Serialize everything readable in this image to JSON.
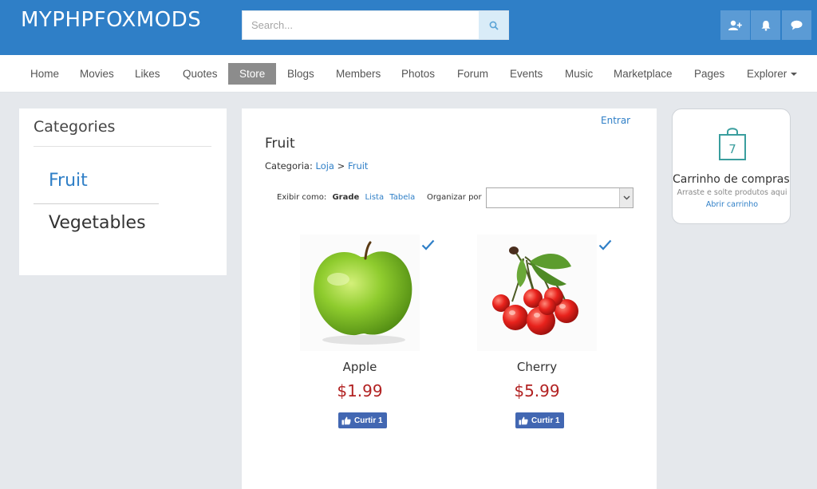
{
  "header": {
    "brand": "MYPHPFOXMODS",
    "search_placeholder": "Search...",
    "icons": [
      "search-icon",
      "add-friend-icon",
      "bell-icon",
      "chat-icon"
    ],
    "brand_color": "#2f7fc7"
  },
  "nav": {
    "items": [
      {
        "label": "Home"
      },
      {
        "label": "Movies"
      },
      {
        "label": "Likes"
      },
      {
        "label": "Quotes"
      },
      {
        "label": "Store"
      },
      {
        "label": "Blogs"
      },
      {
        "label": "Members"
      },
      {
        "label": "Photos"
      },
      {
        "label": "Forum"
      },
      {
        "label": "Events"
      },
      {
        "label": "Music"
      },
      {
        "label": "Marketplace"
      },
      {
        "label": "Pages"
      },
      {
        "label": "Explorer"
      }
    ],
    "active": "Store"
  },
  "categories": {
    "title": "Categories",
    "items": [
      {
        "label": "Fruit"
      },
      {
        "label": "Vegetables"
      }
    ]
  },
  "main": {
    "login_link": "Entrar",
    "title": "Fruit",
    "breadcrumb": {
      "prefix": "Categoria:",
      "store": "Loja",
      "separator": ">",
      "current": "Fruit"
    },
    "view": {
      "label": "Exibir como:",
      "grid": "Grade",
      "list": "Lista",
      "table": "Tabela"
    },
    "sort_label": "Organizar por",
    "sort_value": "",
    "products": [
      {
        "name": "Apple",
        "price": "$1.99",
        "like_label": "Curtir",
        "like_count": "1",
        "image": "apple-image"
      },
      {
        "name": "Cherry",
        "price": "$5.99",
        "like_label": "Curtir",
        "like_count": "1",
        "image": "cherry-image"
      }
    ]
  },
  "cart": {
    "count": "7",
    "title": "Carrinho de compras",
    "hint": "Arraste e solte produtos aqui",
    "link": "Abrir carrinho",
    "accent": "#3a9e9e"
  }
}
